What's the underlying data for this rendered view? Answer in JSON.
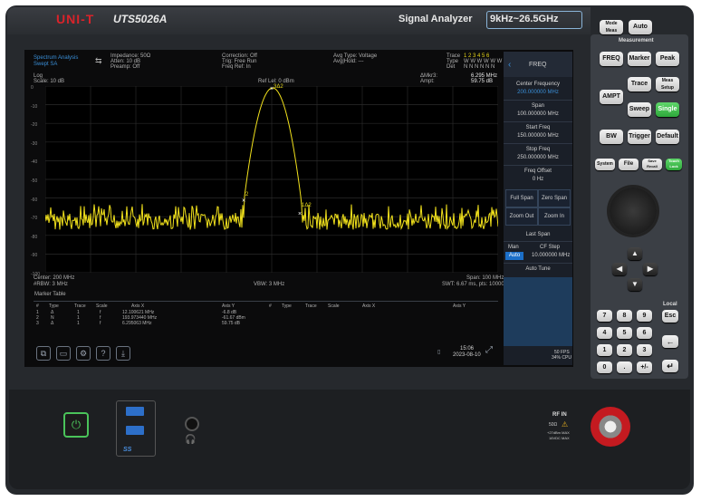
{
  "header": {
    "brand": "UNI-T",
    "model": "UTS5026A",
    "product": "Signal Analyzer",
    "freq_range": "9kHz~26.5GHz"
  },
  "screen_info": {
    "mode": "Spectrum Analysis",
    "mode_sub": "Swept SA",
    "impedance": "Impedance: 50Ω",
    "atten": "Atten: 10 dB",
    "preamp": "Preamp: Off",
    "correction": "Correction: Off",
    "trig": "Trig: Free Run",
    "freq_ref": "Freq Ref: In",
    "avg_type": "Avg Type: Voltage",
    "avg_hold": "Avg|Hold: ---",
    "trace_label": "Trace",
    "type_label": "Type",
    "det_label": "Det",
    "trace_nums": "1 2 3 4 5 6",
    "trace_types": "W W W W W W",
    "trace_dets": "N N N N N N",
    "scale_type": "Log",
    "scale": "Scale: 10 dB",
    "ref_lvl": "Ref Lel: 0 dBm",
    "delta_mkr": "ΔMkr3:",
    "delta_mkr_val": "6.295 MHz",
    "ampt_label": "Ampt:",
    "ampt_val": "59.75 dB",
    "center": "Center: 200 MHz",
    "rbw": "#RBW: 3 MHz",
    "vbw": "VBW: 3 MHz",
    "span": "Span: 100 MHz",
    "swt": "SWT: 6.67 ms, pts: 100001",
    "marker_peak": "3Δ2",
    "marker_left": "2",
    "marker_right": "1Δ2",
    "y_ticks": [
      "0",
      "-10",
      "-20",
      "-30",
      "-40",
      "-50",
      "-60",
      "-70",
      "-80",
      "-90",
      "-100"
    ]
  },
  "right_panel": {
    "title": "FREQ",
    "center_freq": "Center Frequency",
    "center_freq_val": "200.000000 MHz",
    "span": "Span",
    "span_val": "100.000000 MHz",
    "start_freq": "Start Freq",
    "start_freq_val": "150.000000 MHz",
    "stop_freq": "Stop Freq",
    "stop_freq_val": "250.000000 MHz",
    "freq_offset": "Freq Offset",
    "freq_offset_val": "0 Hz",
    "full_span": "Full Span",
    "zero_span": "Zero Span",
    "zoom_out": "Zoom Out",
    "zoom_in": "Zoom In",
    "last_span": "Last Span",
    "man": "Man",
    "auto": "Auto",
    "cf_step": "CF Step",
    "cf_step_val": "10.000000 MHz",
    "auto_tune": "Auto Tune",
    "fps": "50 FPS",
    "cpu": "34% CPU"
  },
  "marker_table": {
    "title": "Marker Table",
    "headers": [
      "#",
      "Type",
      "Trace",
      "Scale",
      "Axis X",
      "Axis Y"
    ],
    "headers_right": [
      "#",
      "Type",
      "Trace",
      "Scale",
      "Axis X",
      "Axis Y"
    ],
    "rows": [
      [
        "1",
        "Δ",
        "1",
        "f",
        "12.100621 MHz",
        "-6.8 dB"
      ],
      [
        "2",
        "N",
        "1",
        "f",
        "193.973440 MHz",
        "-61.67 dBm"
      ],
      [
        "3",
        "Δ",
        "1",
        "f",
        "6.295063 MHz",
        "59.75 dB"
      ]
    ]
  },
  "status": {
    "time": "15:06",
    "date": "2023-08-10"
  },
  "keys": {
    "measurement": "Measurement",
    "mode_meas": "Mode Meas",
    "auto": "Auto",
    "freq": "FREQ",
    "marker": "Marker",
    "peak": "Peak",
    "ampt": "AMPT",
    "trace": "Trace",
    "mode_setup": "Meas Setup",
    "sweep": "Sweep",
    "single": "Single",
    "bw": "BW",
    "trigger": "Trigger",
    "default": "Default",
    "system": "System",
    "file": "File",
    "save_recall": "Save Recall",
    "touch_lock": "Touch Lock",
    "local": "Local",
    "esc": "Esc",
    "digits": [
      "7",
      "8",
      "9",
      "4",
      "5",
      "6",
      "1",
      "2",
      "3",
      "0",
      ".",
      "+/-"
    ]
  },
  "bottom": {
    "ss": "SS",
    "rf_in": "RF IN",
    "impedance": "50Ω",
    "max_power": "+27dBm MAX",
    "max_dc": "16VDC MAX"
  },
  "chart_data": {
    "type": "line",
    "x_range": [
      "150 MHz",
      "250 MHz"
    ],
    "ylim": [
      -100,
      0
    ],
    "series": [
      {
        "values": []
      }
    ]
  }
}
